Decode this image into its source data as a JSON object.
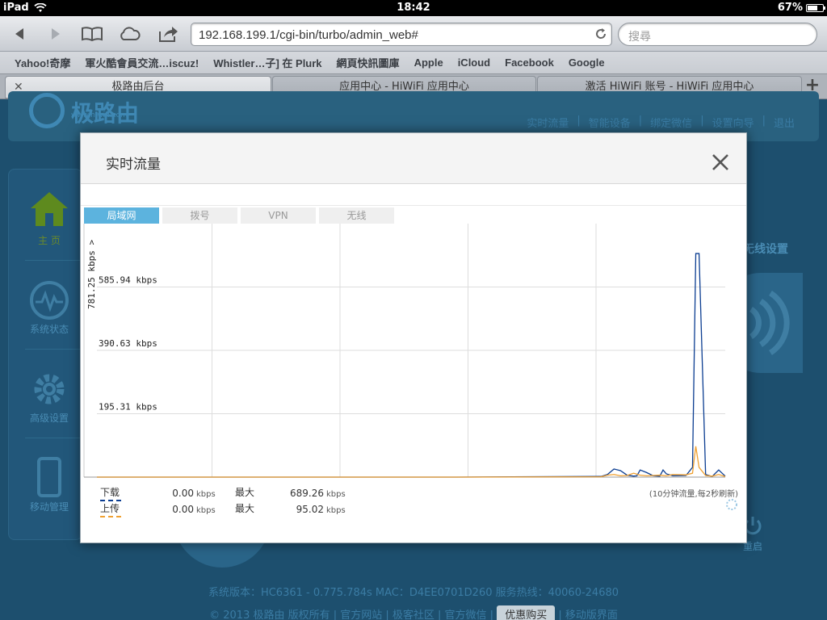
{
  "status_bar": {
    "device": "iPad",
    "time": "18:42",
    "battery": "67%"
  },
  "browser": {
    "url": "192.168.199.1/cgi-bin/turbo/admin_web#",
    "search_placeholder": "搜尋",
    "bookmarks": [
      "Yahoo!奇摩",
      "軍火酷會員交流…iscuz!",
      "Whistler…子] 在 Plurk",
      "網頁快訊圖庫",
      "Apple",
      "iCloud",
      "Facebook",
      "Google"
    ],
    "tabs": [
      {
        "label": "极路由后台"
      },
      {
        "label": "应用中心 - HiWiFi 应用中心"
      },
      {
        "label": "激活 HiWiFi 账号 - HiWiFi 应用中心"
      }
    ]
  },
  "background_page": {
    "logo": "极路由",
    "logo_url": "www.hiwifi.com",
    "header_links": [
      "实时流量",
      "|",
      "智能设备",
      "|",
      "绑定微信",
      "|",
      "设置向导",
      "|",
      "退出"
    ],
    "sidebar": [
      {
        "label": "主 页"
      },
      {
        "label": "系统状态"
      },
      {
        "label": "高级设置"
      },
      {
        "label": "移动管理"
      }
    ],
    "wifi_label": "无线设置",
    "reboot_label": "重启",
    "footer_line1": "系统版本：HC6361 - 0.775.784s     MAC：D4EE0701D260     服务热线：40060-24680",
    "footer_line2_left": "© 2013 极路由 版权所有  |  官方网站  |  极客社区  |  官方微信  |",
    "footer_badge": "优惠购买",
    "footer_line2_right": "|  移动版界面"
  },
  "modal": {
    "title": "实时流量",
    "tabs": [
      "局域网",
      "拨号",
      "VPN",
      "无线"
    ],
    "active_tab": 0,
    "legend": [
      {
        "name": "下载",
        "value": "0.00",
        "unit": "kbps",
        "max_label": "最大",
        "max_value": "689.26",
        "max_unit": "kbps",
        "color": "#0b3d91"
      },
      {
        "name": "上传",
        "value": "0.00",
        "unit": "kbps",
        "max_label": "最大",
        "max_value": "95.02",
        "max_unit": "kbps",
        "color": "#f0a030"
      }
    ],
    "refresh_note": "(10分钟流量,每2秒刷新)"
  },
  "chart_data": {
    "type": "line",
    "ylabel": "781.25 kbps >",
    "y_ticks": [
      {
        "value": 585.94,
        "label": "585.94 kbps"
      },
      {
        "value": 390.63,
        "label": "390.63 kbps"
      },
      {
        "value": 195.31,
        "label": "195.31 kbps"
      }
    ],
    "ylim": [
      0,
      781.25
    ],
    "x_gridlines": 5,
    "grid": true,
    "series": [
      {
        "name": "下载",
        "color": "#0b3d91",
        "x": [
          0,
          55,
          77,
          78,
          79,
          80,
          81,
          82,
          82.5,
          83,
          84,
          85,
          86,
          86.5,
          87,
          88,
          90,
          91,
          91.5,
          92,
          93,
          94,
          95,
          96
        ],
        "values": [
          0,
          0,
          2,
          8,
          25,
          20,
          6,
          3,
          4,
          22,
          14,
          4,
          3,
          22,
          10,
          4,
          5,
          30,
          689,
          689,
          8,
          2,
          22,
          3
        ]
      },
      {
        "name": "上传",
        "color": "#f0a030",
        "x": [
          0,
          55,
          77,
          78,
          79,
          80,
          81,
          82,
          83,
          84,
          85,
          86,
          87,
          88,
          90,
          91,
          91.5,
          92,
          93,
          94,
          95,
          96
        ],
        "values": [
          0,
          0,
          1,
          6,
          8,
          4,
          5,
          12,
          6,
          4,
          5,
          6,
          4,
          8,
          7,
          12,
          95,
          30,
          5,
          3,
          8,
          2
        ]
      }
    ]
  }
}
